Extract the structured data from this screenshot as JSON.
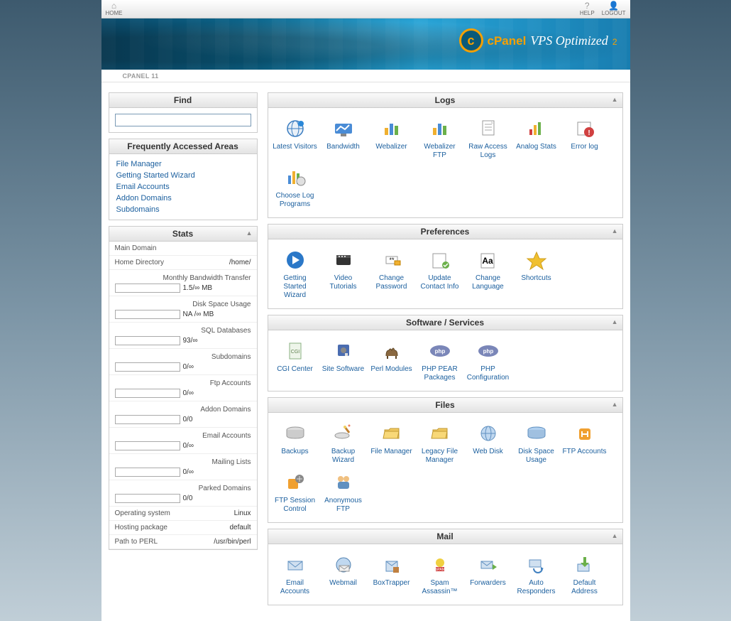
{
  "topbar": {
    "home": "HOME",
    "help": "HELP",
    "logout": "LOGOUT"
  },
  "brand": {
    "cpanel": "cPanel",
    "vps": "VPS Optimized",
    "sub": "2",
    "subbar": "CPANEL 11"
  },
  "sidebar": {
    "find": {
      "title": "Find"
    },
    "freq": {
      "title": "Frequently Accessed Areas",
      "links": [
        "File Manager",
        "Getting Started Wizard",
        "Email Accounts",
        "Addon Domains",
        "Subdomains"
      ]
    },
    "stats": {
      "title": "Stats",
      "main_domain_label": "Main Domain",
      "main_domain_value": "",
      "home_dir_label": "Home Directory",
      "home_dir_value": "/home/",
      "items": [
        {
          "label": "Monthly Bandwidth Transfer",
          "value": "1.5/∞ MB"
        },
        {
          "label": "Disk Space Usage",
          "value": "NA /∞ MB"
        },
        {
          "label": "SQL Databases",
          "value": "93/∞"
        },
        {
          "label": "Subdomains",
          "value": "0/∞"
        },
        {
          "label": "Ftp Accounts",
          "value": "0/∞"
        },
        {
          "label": "Addon Domains",
          "value": "0/0"
        },
        {
          "label": "Email Accounts",
          "value": "0/∞"
        },
        {
          "label": "Mailing Lists",
          "value": "0/∞"
        },
        {
          "label": "Parked Domains",
          "value": "0/0"
        }
      ],
      "plain": [
        {
          "label": "Operating system",
          "value": "Linux"
        },
        {
          "label": "Hosting package",
          "value": "default"
        },
        {
          "label": "Path to PERL",
          "value": "/usr/bin/perl"
        }
      ]
    }
  },
  "sections": [
    {
      "title": "Logs",
      "items": [
        {
          "name": "latest-visitors",
          "label": "Latest Visitors",
          "icon": "globe"
        },
        {
          "name": "bandwidth",
          "label": "Bandwidth",
          "icon": "chart"
        },
        {
          "name": "webalizer",
          "label": "Webalizer",
          "icon": "barchart"
        },
        {
          "name": "webalizer-ftp",
          "label": "Webalizer FTP",
          "icon": "barchart"
        },
        {
          "name": "raw-access-logs",
          "label": "Raw Access Logs",
          "icon": "doc"
        },
        {
          "name": "analog-stats",
          "label": "Analog Stats",
          "icon": "bars"
        },
        {
          "name": "error-log",
          "label": "Error log",
          "icon": "error"
        },
        {
          "name": "choose-log-programs",
          "label": "Choose Log Programs",
          "icon": "barchart2"
        }
      ]
    },
    {
      "title": "Preferences",
      "items": [
        {
          "name": "getting-started-wizard",
          "label": "Getting Started Wizard",
          "icon": "play"
        },
        {
          "name": "video-tutorials",
          "label": "Video Tutorials",
          "icon": "video"
        },
        {
          "name": "change-password",
          "label": "Change Password",
          "icon": "password"
        },
        {
          "name": "update-contact-info",
          "label": "Update Contact Info",
          "icon": "contact"
        },
        {
          "name": "change-language",
          "label": "Change Language",
          "icon": "language"
        },
        {
          "name": "shortcuts",
          "label": "Shortcuts",
          "icon": "star"
        }
      ]
    },
    {
      "title": "Software / Services",
      "items": [
        {
          "name": "cgi-center",
          "label": "CGI Center",
          "icon": "doc2"
        },
        {
          "name": "site-software",
          "label": "Site Software",
          "icon": "disk"
        },
        {
          "name": "perl-modules",
          "label": "Perl Modules",
          "icon": "camel"
        },
        {
          "name": "php-pear-packages",
          "label": "PHP PEAR Packages",
          "icon": "php"
        },
        {
          "name": "php-configuration",
          "label": "PHP Configuration",
          "icon": "php"
        }
      ]
    },
    {
      "title": "Files",
      "items": [
        {
          "name": "backups",
          "label": "Backups",
          "icon": "hdd"
        },
        {
          "name": "backup-wizard",
          "label": "Backup Wizard",
          "icon": "wand"
        },
        {
          "name": "file-manager",
          "label": "File Manager",
          "icon": "folder"
        },
        {
          "name": "legacy-file-manager",
          "label": "Legacy File Manager",
          "icon": "folder"
        },
        {
          "name": "web-disk",
          "label": "Web Disk",
          "icon": "webdisk"
        },
        {
          "name": "disk-space-usage",
          "label": "Disk Space Usage",
          "icon": "hdd2"
        },
        {
          "name": "ftp-accounts",
          "label": "FTP Accounts",
          "icon": "ftp"
        },
        {
          "name": "ftp-session-control",
          "label": "FTP Session Control",
          "icon": "ftpctl"
        },
        {
          "name": "anonymous-ftp",
          "label": "Anonymous FTP",
          "icon": "anonftp"
        }
      ]
    },
    {
      "title": "Mail",
      "items": [
        {
          "name": "email-accounts",
          "label": "Email Accounts",
          "icon": "mail"
        },
        {
          "name": "webmail",
          "label": "Webmail",
          "icon": "webmail"
        },
        {
          "name": "boxtrapper",
          "label": "BoxTrapper",
          "icon": "box"
        },
        {
          "name": "spam-assassin",
          "label": "Spam Assassin™",
          "icon": "spam"
        },
        {
          "name": "forwarders",
          "label": "Forwarders",
          "icon": "forward"
        },
        {
          "name": "auto-responders",
          "label": "Auto Responders",
          "icon": "auto"
        },
        {
          "name": "default-address",
          "label": "Default Address",
          "icon": "default"
        }
      ]
    }
  ]
}
